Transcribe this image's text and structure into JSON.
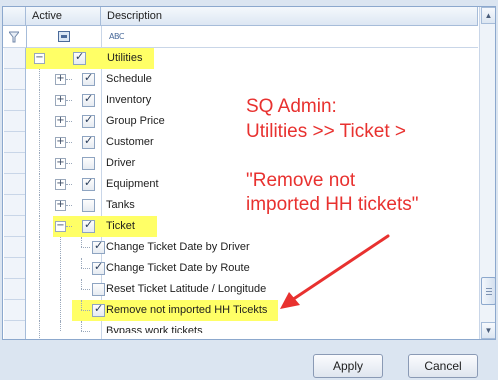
{
  "columns": {
    "active": "Active",
    "description": "Description"
  },
  "filter": {
    "filter_icon": "funnel-icon",
    "active_icon": "checkbox-filter-icon",
    "desc_icon": "abc-icon",
    "desc_text": "ABC"
  },
  "tree": {
    "utilities": "Utilities",
    "schedule": "Schedule",
    "inventory": "Inventory",
    "group_price": "Group Price",
    "customer": "Customer",
    "driver": "Driver",
    "equipment": "Equipment",
    "tanks": "Tanks",
    "ticket": "Ticket",
    "change_date_driver": "Change Ticket Date by Driver",
    "change_date_route": "Change Ticket Date by Route",
    "reset_lat_long": "Reset Ticket Latitude / Longitude",
    "remove_not_imported": "Remove not imported HH Ticekts",
    "partial_next": "Bypass work tickets"
  },
  "checked": {
    "utilities": true,
    "schedule": true,
    "inventory": true,
    "group_price": true,
    "customer": true,
    "driver": false,
    "equipment": true,
    "tanks": false,
    "ticket": true,
    "change_date_driver": true,
    "change_date_route": true,
    "reset_lat_long": false,
    "remove_not_imported": true
  },
  "annotation": {
    "line1": "SQ Admin:",
    "line2": "Utilities >> Ticket >",
    "line3": "\"Remove not",
    "line4": "imported HH tickets\"",
    "color": "#e8312f"
  },
  "highlight_color": "#ffff66",
  "buttons": {
    "apply": "Apply",
    "cancel": "Cancel"
  }
}
